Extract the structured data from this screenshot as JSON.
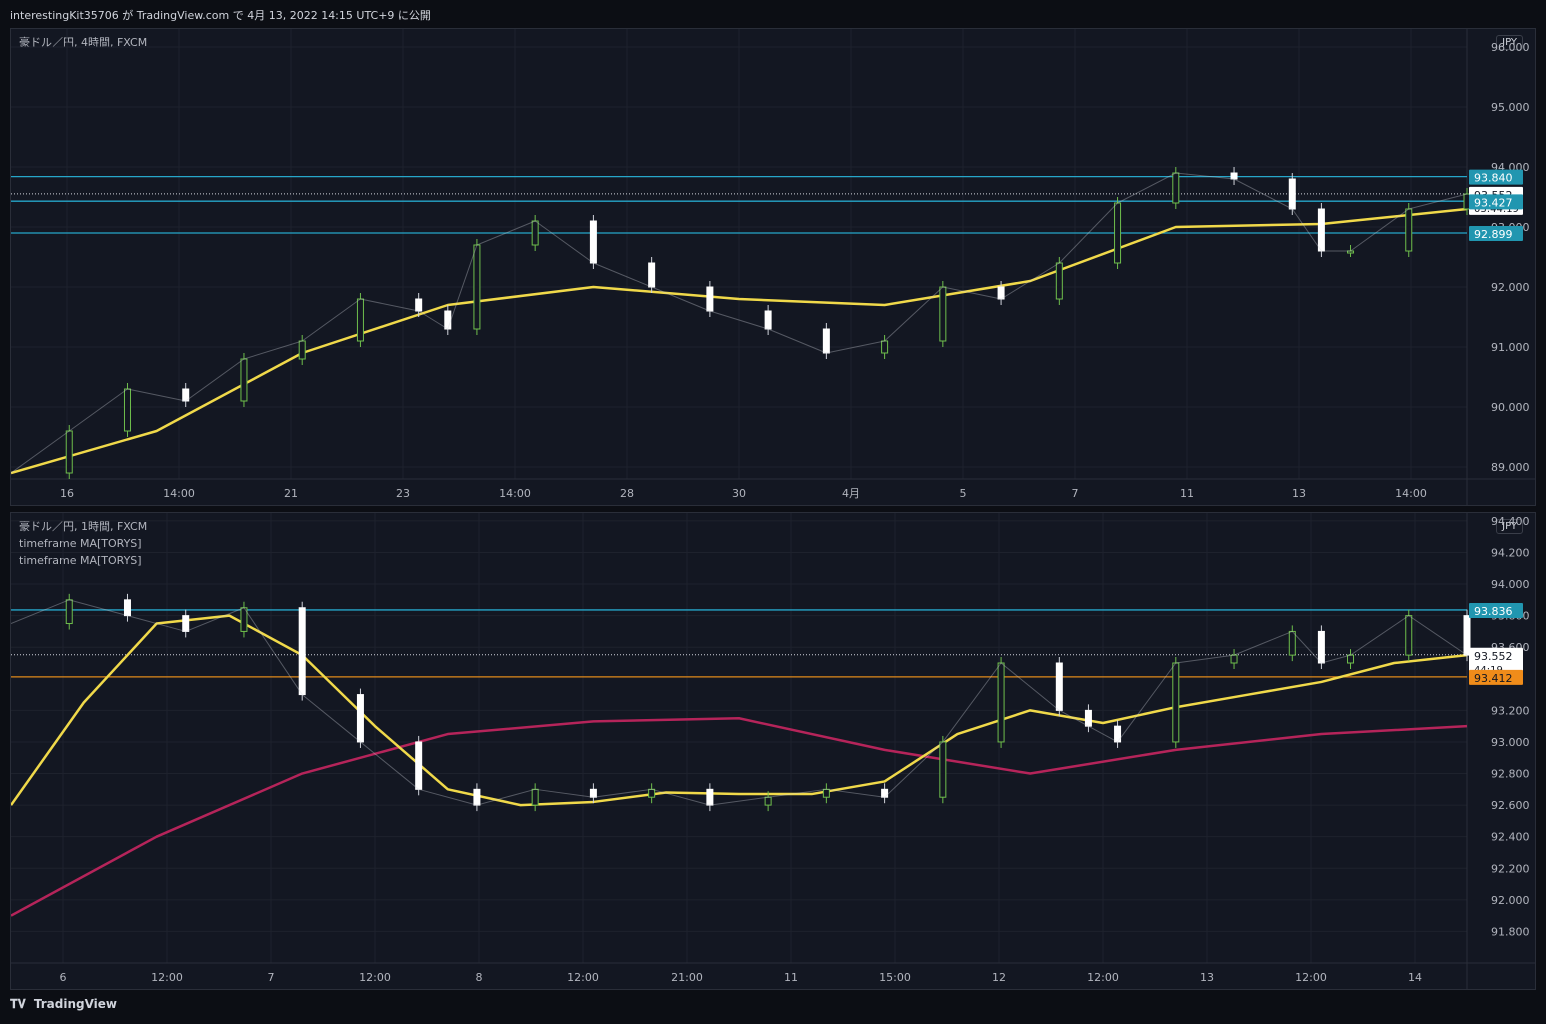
{
  "header": {
    "publish_line": "interestingKit35706 が TradingView.com で 4月 13, 2022 14:15 UTC+9 に公開"
  },
  "footer": {
    "brand": "TradingView"
  },
  "charts": [
    {
      "legend": [
        "豪ドル／円, 4時間, FXCM"
      ],
      "currency": "JPY",
      "y_ticks": [
        "96.000",
        "95.000",
        "94.000",
        "93.000",
        "92.000",
        "91.000",
        "90.000",
        "89.000"
      ],
      "x_ticks": [
        "16",
        "14:00",
        "21",
        "23",
        "14:00",
        "28",
        "30",
        "4月",
        "5",
        "7",
        "11",
        "13",
        "14:00"
      ],
      "price_tags": [
        {
          "label": "93.840",
          "kind": "cyan"
        },
        {
          "label": "93.552",
          "kind": "white",
          "sub": "03:44:19"
        },
        {
          "label": "93.427",
          "kind": "cyan"
        },
        {
          "label": "92.899",
          "kind": "cyan"
        }
      ]
    },
    {
      "legend": [
        "豪ドル／円, 1時間, FXCM",
        "timeframe MA[TORYS]",
        "timeframe MA[TORYS]"
      ],
      "currency": "JPY",
      "y_ticks": [
        "94.400",
        "94.200",
        "94.000",
        "93.800",
        "93.600",
        "93.200",
        "93.000",
        "92.800",
        "92.600",
        "92.400",
        "92.200",
        "92.000",
        "91.800"
      ],
      "x_ticks": [
        "6",
        "12:00",
        "7",
        "12:00",
        "8",
        "12:00",
        "21:00",
        "11",
        "15:00",
        "12",
        "12:00",
        "13",
        "12:00",
        "14"
      ],
      "price_tags": [
        {
          "label": "93.836",
          "kind": "cyan"
        },
        {
          "label": "93.552",
          "kind": "white",
          "sub": "44:19"
        },
        {
          "label": "93.412",
          "kind": "orange"
        }
      ]
    }
  ],
  "chart_data": [
    {
      "type": "line",
      "title": "豪ドル／円, 4時間, FXCM",
      "ylim": [
        88.8,
        96.3
      ],
      "y_ticks": [
        96,
        95,
        94,
        93,
        92,
        91,
        90,
        89
      ],
      "close_series": {
        "name": "豪ドル／円",
        "x": [
          0,
          0.04,
          0.08,
          0.12,
          0.16,
          0.2,
          0.24,
          0.28,
          0.3,
          0.32,
          0.36,
          0.4,
          0.44,
          0.48,
          0.52,
          0.56,
          0.6,
          0.64,
          0.68,
          0.72,
          0.76,
          0.8,
          0.84,
          0.88,
          0.9,
          0.92,
          0.96,
          1.0
        ],
        "values": [
          88.9,
          89.6,
          90.3,
          90.1,
          90.8,
          91.1,
          91.8,
          91.6,
          91.3,
          92.7,
          93.1,
          92.4,
          92.0,
          91.6,
          91.3,
          90.9,
          91.1,
          92.0,
          91.8,
          92.4,
          93.4,
          93.9,
          93.8,
          93.3,
          92.6,
          92.6,
          93.3,
          93.55
        ]
      },
      "moving_average": {
        "x": [
          0,
          0.1,
          0.2,
          0.3,
          0.4,
          0.5,
          0.6,
          0.7,
          0.8,
          0.9,
          1.0
        ],
        "values": [
          88.9,
          89.6,
          90.9,
          91.7,
          92.0,
          91.8,
          91.7,
          92.1,
          93.0,
          93.05,
          93.3
        ]
      },
      "horizontal_levels": [
        93.84,
        93.43,
        92.9
      ],
      "last_price": 93.552
    },
    {
      "type": "line",
      "title": "豪ドル／円, 1時間, FXCM",
      "ylim": [
        91.6,
        94.45
      ],
      "y_ticks": [
        94.4,
        94.2,
        94.0,
        93.8,
        93.6,
        93.2,
        93.0,
        92.8,
        92.6,
        92.4,
        92.2,
        92.0,
        91.8
      ],
      "close_series": {
        "name": "豪ドル／円",
        "x": [
          0,
          0.04,
          0.08,
          0.12,
          0.16,
          0.2,
          0.24,
          0.28,
          0.32,
          0.36,
          0.4,
          0.44,
          0.48,
          0.52,
          0.56,
          0.6,
          0.64,
          0.68,
          0.72,
          0.74,
          0.76,
          0.8,
          0.84,
          0.88,
          0.9,
          0.92,
          0.96,
          1.0
        ],
        "values": [
          93.75,
          93.9,
          93.8,
          93.7,
          93.85,
          93.3,
          93.0,
          92.7,
          92.6,
          92.7,
          92.65,
          92.7,
          92.6,
          92.65,
          92.7,
          92.65,
          93.0,
          93.5,
          93.2,
          93.1,
          93.0,
          93.5,
          93.55,
          93.7,
          93.5,
          93.55,
          93.8,
          93.55
        ]
      },
      "moving_average_fast": {
        "x": [
          0,
          0.05,
          0.1,
          0.15,
          0.2,
          0.25,
          0.3,
          0.35,
          0.4,
          0.45,
          0.5,
          0.55,
          0.6,
          0.65,
          0.7,
          0.75,
          0.8,
          0.85,
          0.9,
          0.95,
          1.0
        ],
        "values": [
          92.6,
          93.25,
          93.75,
          93.8,
          93.55,
          93.1,
          92.7,
          92.6,
          92.62,
          92.68,
          92.67,
          92.67,
          92.75,
          93.05,
          93.2,
          93.12,
          93.22,
          93.3,
          93.38,
          93.5,
          93.55
        ]
      },
      "moving_average_slow": {
        "x": [
          0,
          0.1,
          0.2,
          0.3,
          0.4,
          0.5,
          0.6,
          0.7,
          0.8,
          0.9,
          1.0
        ],
        "values": [
          91.9,
          92.4,
          92.8,
          93.05,
          93.13,
          93.15,
          92.95,
          92.8,
          92.95,
          93.05,
          93.1
        ]
      },
      "horizontal_levels": [
        93.836,
        93.412
      ],
      "last_price": 93.552
    }
  ]
}
